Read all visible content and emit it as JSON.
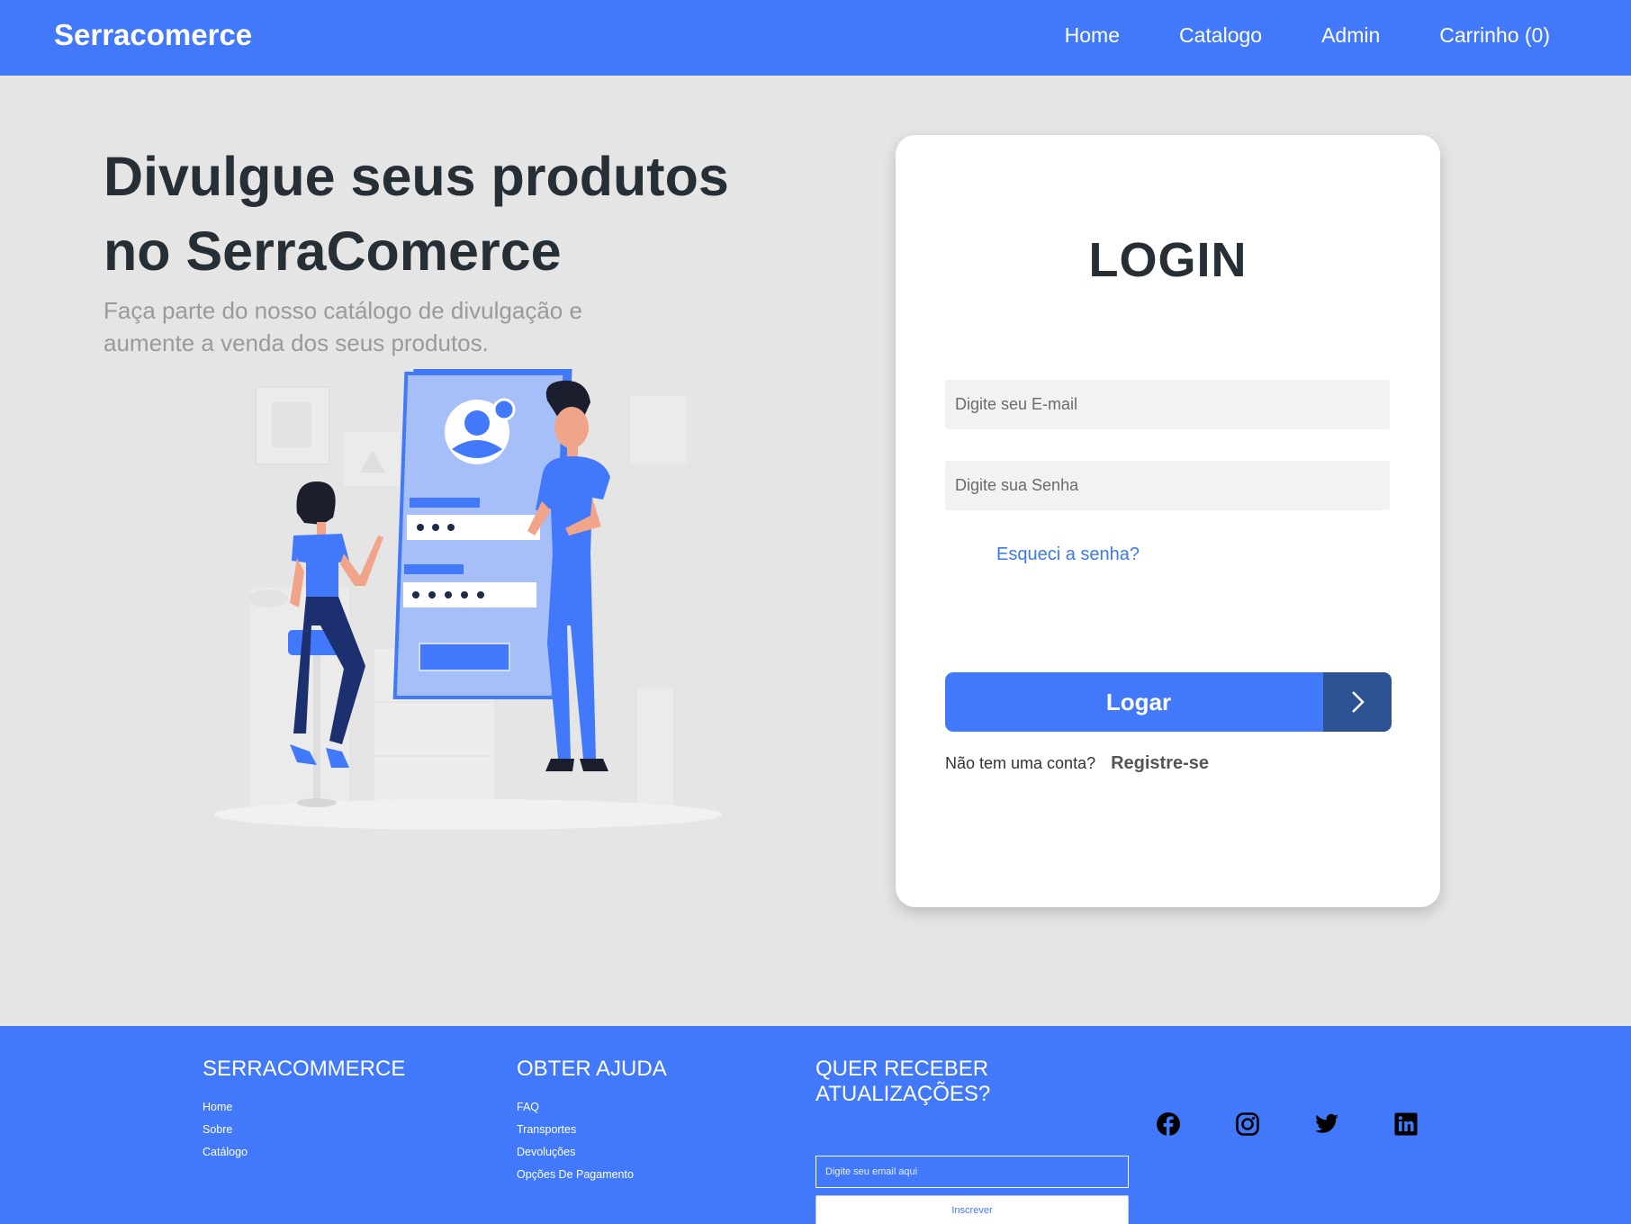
{
  "nav": {
    "brand": "Serracomerce",
    "links": [
      "Home",
      "Catalogo",
      "Admin",
      "Carrinho (0)"
    ]
  },
  "hero": {
    "title_line1": "Divulgue seus produtos",
    "title_line2": "no SerraComerce",
    "subtitle": "Faça parte do nosso catálogo de divulgação e aumente a venda dos seus produtos."
  },
  "login": {
    "title": "LOGIN",
    "email_placeholder": "Digite seu E-mail",
    "password_placeholder": "Digite sua Senha",
    "forgot": "Esqueci a senha?",
    "submit": "Logar",
    "no_account": "Não tem uma conta?",
    "register": "Registre-se"
  },
  "footer": {
    "brand_heading": "SERRACOMMERCE",
    "brand_links": [
      "Home",
      "Sobre",
      "Catálogo"
    ],
    "help_heading": "OBTER AJUDA",
    "help_links": [
      "FAQ",
      "Transportes",
      "Devoluções",
      "Opções De Pagamento"
    ],
    "newsletter_heading": "QUER RECEBER ATUALIZAÇÕES?",
    "newsletter_placeholder": "Digite seu email aqui",
    "newsletter_button": "Inscrever",
    "socials": [
      "facebook-icon",
      "instagram-icon",
      "twitter-icon",
      "linkedin-icon"
    ]
  },
  "colors": {
    "primary": "#4179fa",
    "primary_dark": "#2e5394",
    "background": "#e5e5e5",
    "heading": "#262f36"
  }
}
